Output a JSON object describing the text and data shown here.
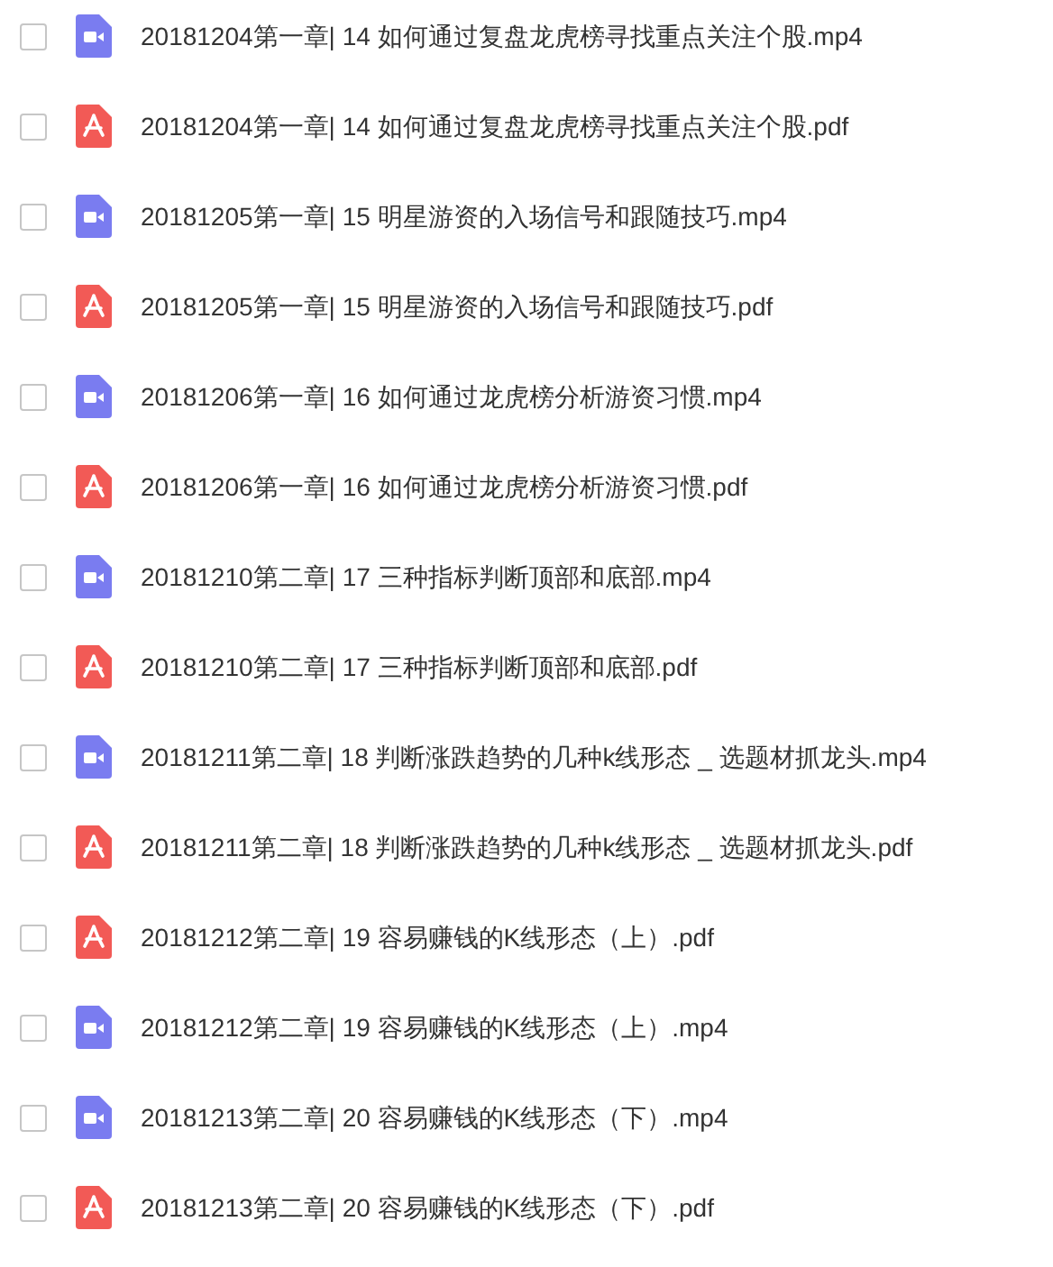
{
  "files": [
    {
      "kind": "video",
      "name": "20181204第一章| 14 如何通过复盘龙虎榜寻找重点关注个股.mp4",
      "checked": false
    },
    {
      "kind": "pdf",
      "name": "20181204第一章| 14 如何通过复盘龙虎榜寻找重点关注个股.pdf",
      "checked": false
    },
    {
      "kind": "video",
      "name": "20181205第一章| 15 明星游资的入场信号和跟随技巧.mp4",
      "checked": false
    },
    {
      "kind": "pdf",
      "name": "20181205第一章| 15 明星游资的入场信号和跟随技巧.pdf",
      "checked": false
    },
    {
      "kind": "video",
      "name": "20181206第一章| 16 如何通过龙虎榜分析游资习惯.mp4",
      "checked": false
    },
    {
      "kind": "pdf",
      "name": "20181206第一章| 16 如何通过龙虎榜分析游资习惯.pdf",
      "checked": false
    },
    {
      "kind": "video",
      "name": "20181210第二章| 17 三种指标判断顶部和底部.mp4",
      "checked": false
    },
    {
      "kind": "pdf",
      "name": "20181210第二章| 17 三种指标判断顶部和底部.pdf",
      "checked": false
    },
    {
      "kind": "video",
      "name": "20181211第二章| 18 判断涨跌趋势的几种k线形态 _ 选题材抓龙头.mp4",
      "checked": false
    },
    {
      "kind": "pdf",
      "name": "20181211第二章| 18 判断涨跌趋势的几种k线形态 _ 选题材抓龙头.pdf",
      "checked": false
    },
    {
      "kind": "pdf",
      "name": "20181212第二章| 19 容易赚钱的K线形态（上）.pdf",
      "checked": false
    },
    {
      "kind": "video",
      "name": "20181212第二章| 19 容易赚钱的K线形态（上）.mp4",
      "checked": false
    },
    {
      "kind": "video",
      "name": "20181213第二章| 20 容易赚钱的K线形态（下）.mp4",
      "checked": false
    },
    {
      "kind": "pdf",
      "name": "20181213第二章| 20 容易赚钱的K线形态（下）.pdf",
      "checked": false
    }
  ]
}
